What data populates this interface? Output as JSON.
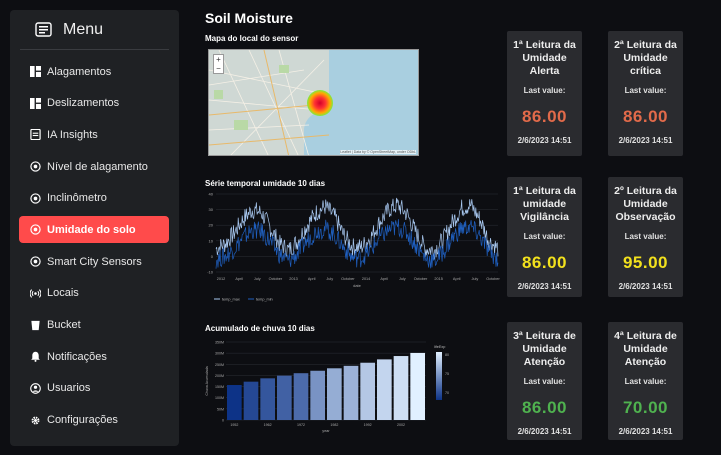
{
  "sidebar": {
    "title": "Menu",
    "items": [
      {
        "label": "Alagamentos",
        "icon": "dashboard-icon"
      },
      {
        "label": "Deslizamentos",
        "icon": "dashboard-icon"
      },
      {
        "label": "IA Insights",
        "icon": "document-icon"
      },
      {
        "label": "Nível de alagamento",
        "icon": "gauge-icon"
      },
      {
        "label": "Inclinômetro",
        "icon": "gauge-icon"
      },
      {
        "label": "Umidade do solo",
        "icon": "gauge-icon",
        "active": true
      },
      {
        "label": "Smart City Sensors",
        "icon": "gauge-icon"
      },
      {
        "label": "Locais",
        "icon": "broadcast-icon"
      },
      {
        "label": "Bucket",
        "icon": "bucket-icon"
      },
      {
        "label": "Notificações",
        "icon": "bell-icon"
      },
      {
        "label": "Usuarios",
        "icon": "user-icon"
      },
      {
        "label": "Configurações",
        "icon": "gear-icon"
      }
    ]
  },
  "main": {
    "title": "Soil Moisture",
    "map_title": "Mapa do local do sensor",
    "timeseries_title": "Série temporal umidade 10 dias",
    "rain_title": "Acumulado de chuva 10 dias",
    "map_zoom_in": "+",
    "map_zoom_out": "−",
    "map_credit": "Leaflet | Data by © OpenStreetMap, under ODbL"
  },
  "cards": [
    {
      "title": "1ª Leitura da Umidade Alerta",
      "label": "Last value:",
      "value": "86.00",
      "date": "2/6/2023 14:51",
      "color": "#e26a4a"
    },
    {
      "title": "2ª Leitura da Umidade crítica",
      "label": "Last value:",
      "value": "86.00",
      "date": "2/6/2023 14:51",
      "color": "#e26a4a"
    },
    {
      "title": "1ª Leitura da umidade Vigilância",
      "label": "Last value:",
      "value": "86.00",
      "date": "2/6/2023 14:51",
      "color": "#f2e11d"
    },
    {
      "title": "2º Leitura da Umidade Observação",
      "label": "Last value:",
      "value": "95.00",
      "date": "2/6/2023 14:51",
      "color": "#f2e11d"
    },
    {
      "title": "3ª Leitura de Umidade Atenção",
      "label": "Last value:",
      "value": "86.00",
      "date": "2/6/2023 14:51",
      "color": "#4fb24f"
    },
    {
      "title": "4ª Leitura de Umidade Atenção",
      "label": "Last value:",
      "value": "70.00",
      "date": "2/6/2023 14:51",
      "color": "#4fb24f"
    }
  ],
  "chart_data": [
    {
      "type": "line",
      "title": "Série temporal umidade 10 dias",
      "xlabel": "date",
      "x_ticks": [
        "2012",
        "April",
        "July",
        "October",
        "2013",
        "April",
        "July",
        "October",
        "2014",
        "April",
        "July",
        "October",
        "2015",
        "April",
        "July",
        "October"
      ],
      "y_ticks": [
        "40",
        "30",
        "20",
        "10",
        "0",
        "-10"
      ],
      "ylim": [
        -10,
        40
      ],
      "series": [
        {
          "name": "temp_max",
          "color": "#a8c8f0",
          "values": [
            5,
            8,
            15,
            24,
            30,
            28,
            18,
            8,
            4,
            10,
            20,
            28,
            32,
            26,
            14,
            6,
            6,
            12,
            22,
            30,
            33,
            27,
            15,
            5,
            4,
            11,
            22,
            31,
            33,
            24,
            10,
            5
          ]
        },
        {
          "name": "temp_min",
          "color": "#1f5fbf",
          "values": [
            -2,
            0,
            5,
            12,
            17,
            16,
            9,
            1,
            -3,
            2,
            10,
            16,
            18,
            14,
            6,
            -1,
            -1,
            4,
            12,
            17,
            19,
            15,
            7,
            -1,
            -3,
            3,
            12,
            18,
            19,
            13,
            3,
            -2
          ]
        }
      ]
    },
    {
      "type": "bar",
      "title": "Acumulado de chuva 10 dias",
      "xlabel": "year",
      "ylabel": "Chuva Acumulada",
      "legend_title": "lifeExp",
      "x_ticks": [
        "1952",
        "1962",
        "1972",
        "1982",
        "1992",
        "2002"
      ],
      "y_ticks": [
        "350M",
        "300M",
        "250M",
        "200M",
        "150M",
        "100M",
        "50M",
        "0"
      ],
      "legend_ticks": [
        "80",
        "75",
        "70"
      ],
      "categories": [
        "1952",
        "1957",
        "1962",
        "1967",
        "1972",
        "1977",
        "1982",
        "1987",
        "1992",
        "1997",
        "2002",
        "2007"
      ],
      "values": [
        157,
        172,
        187,
        199,
        210,
        221,
        232,
        243,
        257,
        272,
        287,
        301
      ],
      "lifeExp": [
        68.4,
        69.5,
        70.2,
        70.8,
        71.3,
        73.4,
        74.7,
        75.0,
        76.1,
        76.8,
        77.3,
        78.2
      ],
      "ylim": [
        0,
        350
      ]
    }
  ]
}
